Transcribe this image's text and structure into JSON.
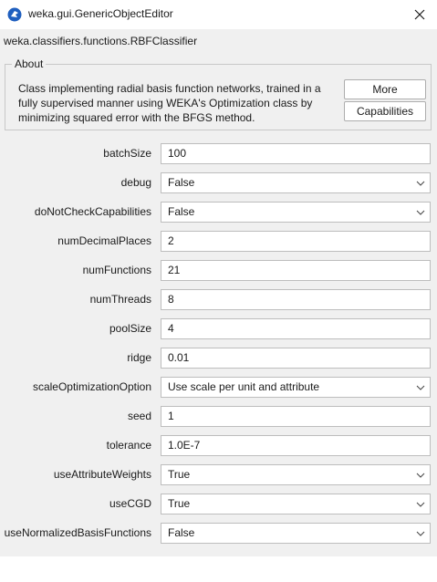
{
  "window": {
    "title": "weka.gui.GenericObjectEditor",
    "app_icon": "weka-bird-icon",
    "close_icon": "close-icon"
  },
  "classifier": {
    "name": "weka.classifiers.functions.RBFClassifier"
  },
  "about": {
    "legend": "About",
    "lines": [
      "Class implementing radial basis function networks, trained in a",
      "fully supervised manner using WEKA's Optimization class by",
      "minimizing squared error with the BFGS method."
    ],
    "more_label": "More",
    "capabilities_label": "Capabilities"
  },
  "properties": {
    "batchSize": {
      "label": "batchSize",
      "value": "100"
    },
    "debug": {
      "label": "debug",
      "value": "False"
    },
    "doNotCheckCapabilities": {
      "label": "doNotCheckCapabilities",
      "value": "False"
    },
    "numDecimalPlaces": {
      "label": "numDecimalPlaces",
      "value": "2"
    },
    "numFunctions": {
      "label": "numFunctions",
      "value": "21"
    },
    "numThreads": {
      "label": "numThreads",
      "value": "8"
    },
    "poolSize": {
      "label": "poolSize",
      "value": "4"
    },
    "ridge": {
      "label": "ridge",
      "value": "0.01"
    },
    "scaleOptimizationOption": {
      "label": "scaleOptimizationOption",
      "value": "Use scale per unit and attribute"
    },
    "seed": {
      "label": "seed",
      "value": "1"
    },
    "tolerance": {
      "label": "tolerance",
      "value": "1.0E-7"
    },
    "useAttributeWeights": {
      "label": "useAttributeWeights",
      "value": "True"
    },
    "useCGD": {
      "label": "useCGD",
      "value": "True"
    },
    "useNormalizedBasisFunctions": {
      "label": "useNormalizedBasisFunctions",
      "value": "False"
    }
  },
  "colors": {
    "panel_bg": "#f0f0f0",
    "field_border": "#bdbdbd",
    "icon_blue": "#1f6fd1"
  }
}
